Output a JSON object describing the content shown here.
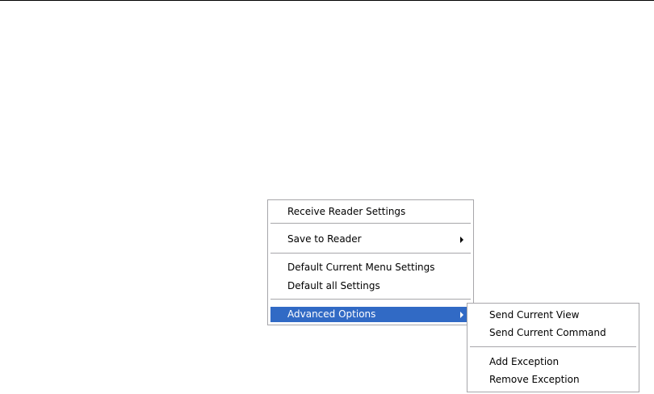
{
  "main_menu": {
    "items": [
      {
        "label": "Receive Reader Settings"
      },
      {
        "label": "Save to Reader",
        "submenu_icon": "chevron-right-icon"
      },
      {
        "label": "Default Current Menu Settings"
      },
      {
        "label": "Default all Settings"
      },
      {
        "label": "Advanced Options",
        "submenu_icon": "chevron-right-icon",
        "highlighted": true
      }
    ]
  },
  "advanced_submenu": {
    "items": [
      {
        "label": "Send Current View"
      },
      {
        "label": "Send Current Command"
      },
      {
        "label": "Add Exception"
      },
      {
        "label": "Remove Exception"
      }
    ]
  },
  "colors": {
    "highlight": "#316ac5",
    "border": "#a7a6aa",
    "menu_bg": "#ffffff"
  }
}
